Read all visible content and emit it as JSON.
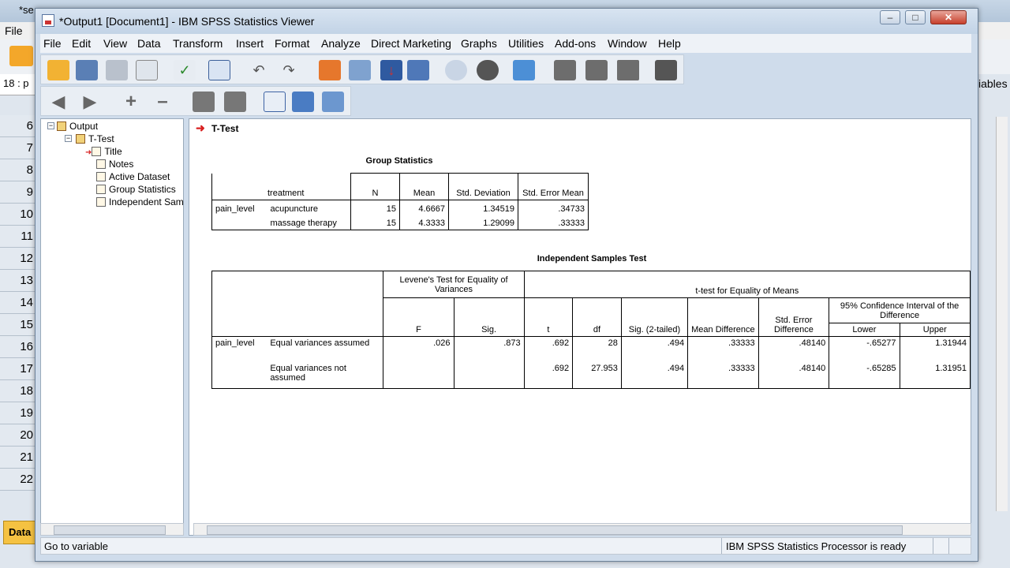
{
  "background": {
    "title": "*se",
    "menu": "File",
    "cell_ref": "18 : p",
    "ables": "iables",
    "row_numbers": [
      "6",
      "7",
      "8",
      "9",
      "10",
      "11",
      "12",
      "13",
      "14",
      "15",
      "16",
      "17",
      "18",
      "19",
      "20",
      "21",
      "22"
    ],
    "data_tab": "Data"
  },
  "window": {
    "title": "*Output1 [Document1] - IBM SPSS Statistics Viewer"
  },
  "menu": [
    "File",
    "Edit",
    "View",
    "Data",
    "Transform",
    "Insert",
    "Format",
    "Analyze",
    "Direct Marketing",
    "Graphs",
    "Utilities",
    "Add-ons",
    "Window",
    "Help"
  ],
  "outline": {
    "root": "Output",
    "section": "T-Test",
    "items": [
      "Title",
      "Notes",
      "Active Dataset",
      "Group Statistics",
      "Independent Sam"
    ]
  },
  "heading": "T-Test",
  "group_statistics": {
    "title": "Group Statistics",
    "headers": {
      "treatment": "treatment",
      "n": "N",
      "mean": "Mean",
      "std_dev": "Std. Deviation",
      "std_err": "Std. Error Mean"
    },
    "variable": "pain_level",
    "rows": [
      {
        "group": "acupuncture",
        "n": "15",
        "mean": "4.6667",
        "sd": "1.34519",
        "se": ".34733"
      },
      {
        "group": "massage therapy",
        "n": "15",
        "mean": "4.3333",
        "sd": "1.29099",
        "se": ".33333"
      }
    ]
  },
  "independent": {
    "title": "Independent Samples Test",
    "levene": "Levene's Test for Equality of Variances",
    "ttest": "t-test for Equality of Means",
    "ci": "95% Confidence Interval of the Difference",
    "cols": {
      "f": "F",
      "sig": "Sig.",
      "t": "t",
      "df": "df",
      "sig2": "Sig. (2-tailed)",
      "md": "Mean Difference",
      "sed": "Std. Error Difference",
      "lower": "Lower",
      "upper": "Upper"
    },
    "variable": "pain_level",
    "rows": [
      {
        "label": "Equal variances assumed",
        "f": ".026",
        "sig": ".873",
        "t": ".692",
        "df": "28",
        "sig2": ".494",
        "md": ".33333",
        "sed": ".48140",
        "lower": "-.65277",
        "upper": "1.31944"
      },
      {
        "label": "Equal variances not assumed",
        "f": "",
        "sig": "",
        "t": ".692",
        "df": "27.953",
        "sig2": ".494",
        "md": ".33333",
        "sed": ".48140",
        "lower": "-.65285",
        "upper": "1.31951"
      }
    ]
  },
  "status": {
    "left": "Go to variable",
    "right": "IBM SPSS Statistics Processor is ready"
  },
  "colors": {
    "accent": "#d82020",
    "title_bar": "#c2d3e6"
  }
}
